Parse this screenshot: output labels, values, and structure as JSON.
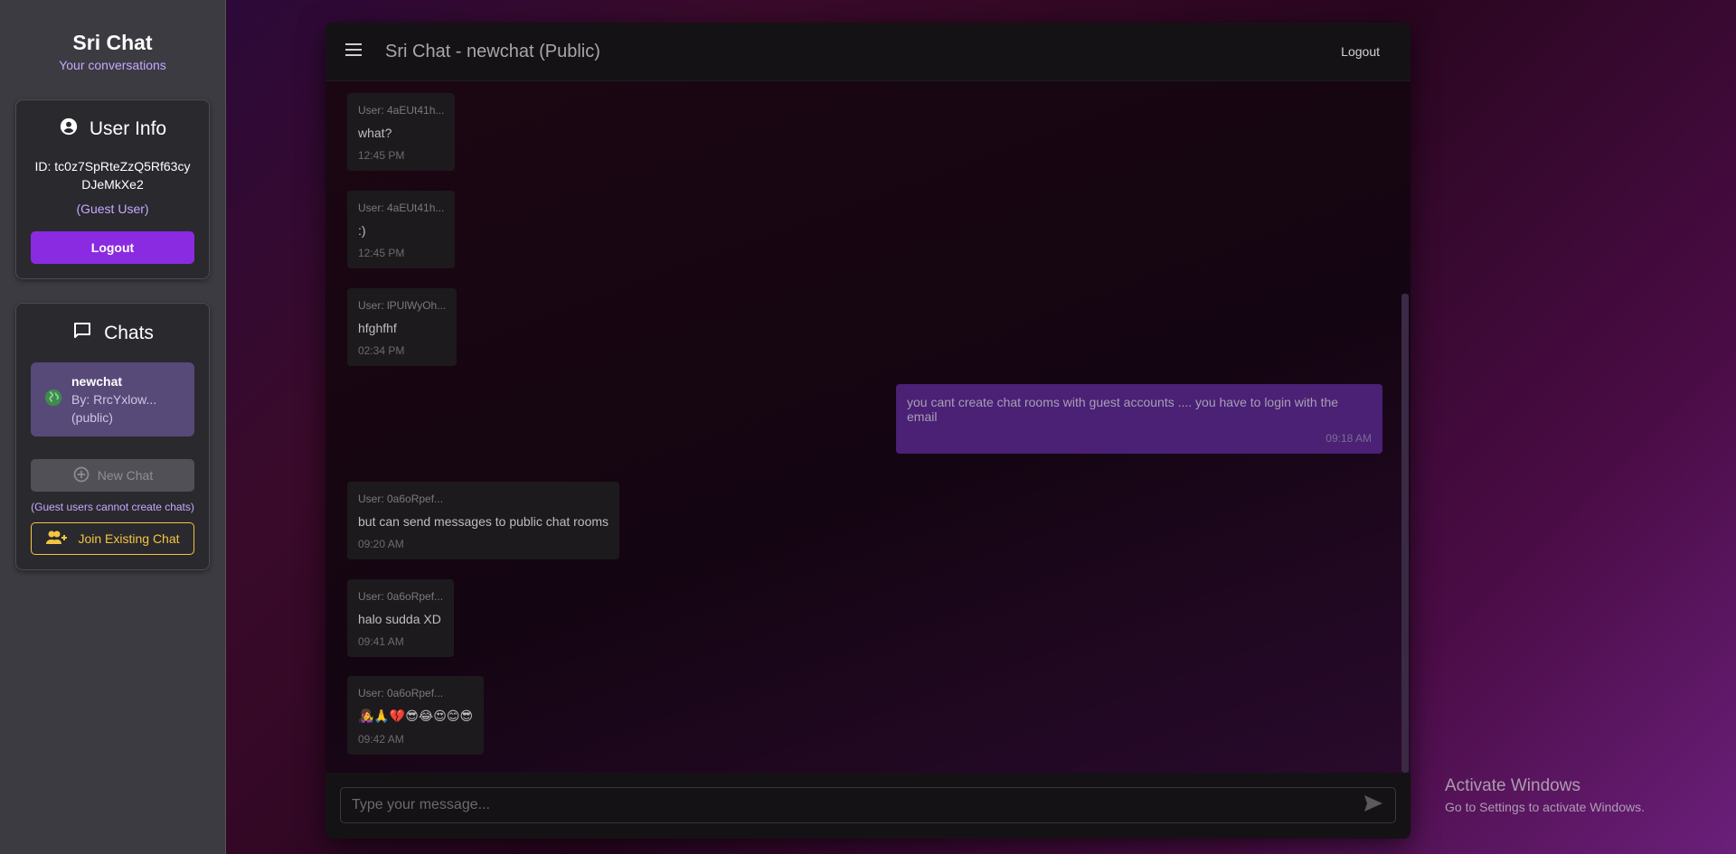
{
  "sidebar": {
    "brand_title": "Sri Chat",
    "brand_subtitle": "Your conversations",
    "user_info": {
      "heading": "User Info",
      "id_text": "ID: tc0z7SpRteZzQ5Rf63cyDJeMkXe2",
      "guest_label": "(Guest User)",
      "logout_label": "Logout"
    },
    "chats": {
      "heading": "Chats",
      "items": [
        {
          "name": "newchat",
          "by": "By: RrcYxlow...",
          "visibility": "(public)",
          "icon": "globe-icon"
        }
      ],
      "new_chat_label": "New Chat",
      "guest_note": "(Guest users cannot create chats)",
      "join_label": "Join Existing Chat"
    }
  },
  "header": {
    "title": "Sri Chat - newchat (Public)",
    "logout_label": "Logout"
  },
  "messages": [
    {
      "sender": "User: 4aEUt41h...",
      "text": "what?",
      "time": "12:45 PM",
      "own": false
    },
    {
      "sender": "User: 4aEUt41h...",
      "text": ":)",
      "time": "12:45 PM",
      "own": false
    },
    {
      "sender": "User: lPUlWyOh...",
      "text": "hfghfhf",
      "time": "02:34 PM",
      "own": false
    },
    {
      "sender": "",
      "text": "you cant create chat rooms with guest accounts .... you have to login with the email",
      "time": "09:18 AM",
      "own": true
    },
    {
      "sender": "User: 0a6oRpef...",
      "text": "but can send messages to public chat rooms",
      "time": "09:20 AM",
      "own": false
    },
    {
      "sender": "User: 0a6oRpef...",
      "text": "halo sudda XD",
      "time": "09:41 AM",
      "own": false
    },
    {
      "sender": "User: 0a6oRpef...",
      "text": "👩‍🎤🙏💔😎😂😍😊😎",
      "time": "09:42 AM",
      "own": false
    }
  ],
  "composer": {
    "placeholder": "Type your message..."
  },
  "watermark": {
    "line1": "Activate Windows",
    "line2": "Go to Settings to activate Windows."
  },
  "colors": {
    "accent": "#8a2be2",
    "join_outline": "#f5c542",
    "own_bubble": "#4a2175"
  }
}
